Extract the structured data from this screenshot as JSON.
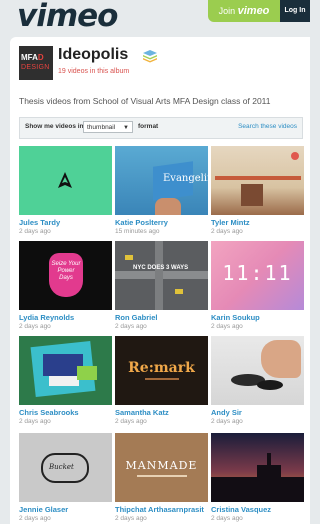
{
  "header": {
    "logo": "vimeo",
    "join_text": "Join",
    "join_brand": "vimeo",
    "login": "Log In"
  },
  "album": {
    "thumb_line1a": "MFA",
    "thumb_line1b": "D",
    "thumb_line2": "DESIGN",
    "title": "Ideopolis",
    "count": "19 videos in this album",
    "description": "Thesis videos from School of Visual Arts MFA Design class of 2011"
  },
  "filter": {
    "show_label": "Show me videos in",
    "view_value": "thumbnail",
    "format_label": "format",
    "search_link": "Search these videos"
  },
  "videos": [
    {
      "author": "Jules Tardy",
      "time": "2 days ago"
    },
    {
      "author": "Katie Poslterry",
      "time": "15 minutes ago",
      "thumb_text": "Evangeline"
    },
    {
      "author": "Tyler Mintz",
      "time": "2 days ago"
    },
    {
      "author": "Lydia Reynolds",
      "time": "2 days ago",
      "thumb_text": "Seize Your Power Days"
    },
    {
      "author": "Ron Gabriel",
      "time": "2 days ago",
      "thumb_text": "NYC DOES 3 WAYS"
    },
    {
      "author": "Karin Soukup",
      "time": "2 days ago",
      "thumb_text": "11:11"
    },
    {
      "author": "Chris Seabrooks",
      "time": "2 days ago"
    },
    {
      "author": "Samantha Katz",
      "time": "2 days ago",
      "thumb_text": "Re:mark"
    },
    {
      "author": "Andy Sir",
      "time": "2 days ago"
    },
    {
      "author": "Jennie Glaser",
      "time": "2 days ago",
      "thumb_text": "Bucket"
    },
    {
      "author": "Thipchat Arthasarnprasit",
      "time": "2 days ago",
      "thumb_text": "MANMADE"
    },
    {
      "author": "Cristina Vasquez",
      "time": "2 days ago"
    }
  ],
  "colors": {
    "brand_dark": "#1a2e3b",
    "join_green": "#9bcd4f",
    "link_blue": "#2d8ec4",
    "count_red": "#d9534f"
  }
}
